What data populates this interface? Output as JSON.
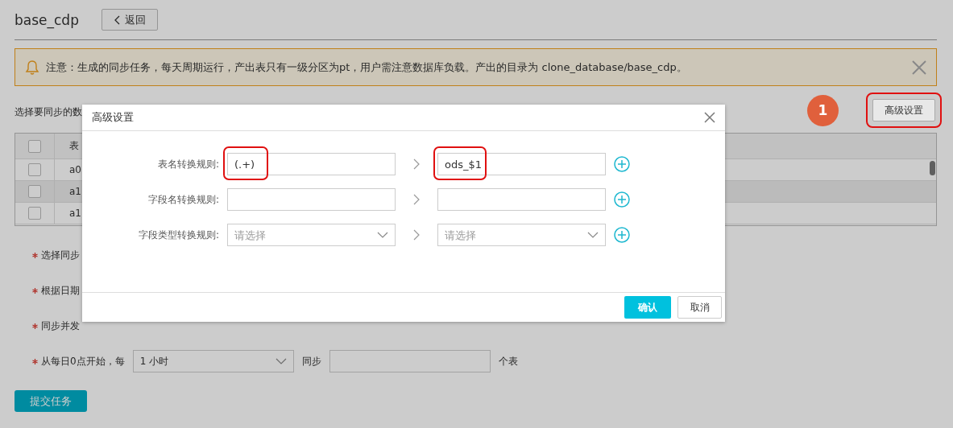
{
  "page": {
    "title": "base_cdp",
    "back_button": "返回"
  },
  "notice": {
    "text": "注意：生成的同步任务，每天周期运行，产出表只有一级分区为pt，用户需注意数据库负载。产出的目录为 clone_database/base_cdp。"
  },
  "section_label": "选择要同步的数",
  "step_badge": "1",
  "advanced_button": {
    "label": "高级设置",
    "highlighted": true
  },
  "table": {
    "header": "表",
    "header_checked": false,
    "rows": [
      {
        "name": "a0",
        "selected": false,
        "checked": false
      },
      {
        "name": "a1",
        "selected": true,
        "checked": false
      },
      {
        "name": "a1",
        "selected": false,
        "checked": false
      }
    ]
  },
  "form": {
    "fields": [
      {
        "label": "选择同步",
        "required": true
      },
      {
        "label": "根据日期",
        "required": true
      },
      {
        "label": "同步并发",
        "required": true
      }
    ],
    "schedule": {
      "label": "从每日0点开始，每",
      "required": true,
      "interval": "1 小时",
      "sync_label": "同步",
      "count_unit": "个表"
    }
  },
  "submit_button": "提交任务",
  "dialog": {
    "title": "高级设置",
    "rules": [
      {
        "label": "表名转换规则:",
        "kind": "text",
        "source": "(.+)",
        "target": "ods_$1",
        "highlighted": true
      },
      {
        "label": "字段名转换规则:",
        "kind": "text",
        "highlighted": false
      },
      {
        "label": "字段类型转换规则:",
        "kind": "select",
        "source_placeholder": "请选择",
        "target_placeholder": "请选择",
        "highlighted": false
      }
    ],
    "confirm": "确认",
    "cancel": "取消"
  }
}
